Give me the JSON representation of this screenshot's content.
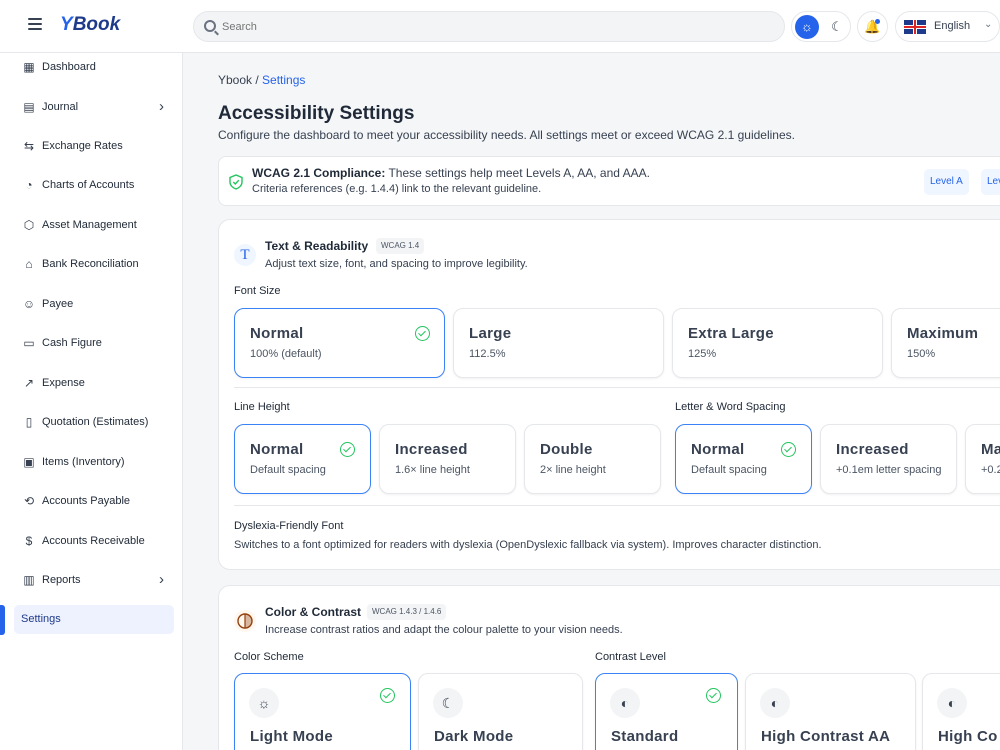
{
  "app": {
    "logo_y": "Y",
    "logo_rest": "Book"
  },
  "search": {
    "placeholder": "Search"
  },
  "language": {
    "label": "English"
  },
  "sidebar": {
    "items": [
      {
        "label": "Dashboard",
        "icon": "grid-icon"
      },
      {
        "label": "Journal",
        "icon": "book-icon"
      },
      {
        "label": "Exchange Rates",
        "icon": "swap-icon"
      },
      {
        "label": "Charts of Accounts",
        "icon": "pie-icon"
      },
      {
        "label": "Asset Management",
        "icon": "box-icon"
      },
      {
        "label": "Bank Reconciliation",
        "icon": "bank-icon"
      },
      {
        "label": "Payee",
        "icon": "users-icon"
      },
      {
        "label": "Cash Figure",
        "icon": "wallet-icon"
      },
      {
        "label": "Expense",
        "icon": "trend-icon"
      },
      {
        "label": "Quotation (Estimates)",
        "icon": "clipboard-icon"
      },
      {
        "label": "Items (Inventory)",
        "icon": "inventory-icon"
      },
      {
        "label": "Accounts Payable",
        "icon": "repeat-icon"
      },
      {
        "label": "Accounts Receivable",
        "icon": "dollar-icon"
      },
      {
        "label": "Reports",
        "icon": "bars-icon"
      },
      {
        "label": "Settings",
        "icon": ""
      }
    ]
  },
  "breadcrumb": {
    "root": "Ybook",
    "sep": " / ",
    "current": "Settings"
  },
  "page": {
    "title": "Accessibility Settings",
    "subtitle": "Configure the dashboard to meet your accessibility needs. All settings meet or exceed WCAG 2.1 guidelines."
  },
  "banner": {
    "bold": "WCAG 2.1 Compliance:",
    "text": " These settings help meet Levels A, AA, and AAA.",
    "line2": "Criteria references (e.g. 1.4.4) link to the relevant guideline.",
    "levels": [
      "Level A",
      "Level AA"
    ]
  },
  "text_section": {
    "icon_glyph": "T",
    "title": "Text & Readability",
    "wcag": "WCAG 1.4",
    "desc": "Adjust text size, font, and spacing to improve legibility.",
    "font_size_label": "Font Size",
    "font_sizes": [
      {
        "title": "Normal",
        "sub": "100% (default)",
        "selected": true
      },
      {
        "title": "Large",
        "sub": "112.5%"
      },
      {
        "title": "Extra Large",
        "sub": "125%"
      },
      {
        "title": "Maximum",
        "sub": "150%"
      }
    ],
    "line_height_label": "Line Height",
    "line_heights": [
      {
        "title": "Normal",
        "sub": "Default spacing",
        "selected": true
      },
      {
        "title": "Increased",
        "sub": "1.6× line height"
      },
      {
        "title": "Double",
        "sub": "2× line height"
      }
    ],
    "spacing_label": "Letter & Word Spacing",
    "spacings": [
      {
        "title": "Normal",
        "sub": "Default spacing",
        "selected": true
      },
      {
        "title": "Increased",
        "sub": "+0.1em letter spacing"
      },
      {
        "title": "Ma",
        "sub": "+0.2"
      }
    ],
    "dyslexia_title": "Dyslexia-Friendly Font",
    "dyslexia_desc": "Switches to a font optimized for readers with dyslexia (OpenDyslexic fallback via system). Improves character distinction."
  },
  "color_section": {
    "title": "Color & Contrast",
    "wcag": "WCAG 1.4.3 / 1.4.6",
    "desc": "Increase contrast ratios and adapt the colour palette to your vision needs.",
    "scheme_label": "Color Scheme",
    "schemes": [
      {
        "title": "Light Mode",
        "icon": "sun-icon",
        "glyph": "☼",
        "selected": true
      },
      {
        "title": "Dark Mode",
        "icon": "moon-icon",
        "glyph": "☾"
      }
    ],
    "contrast_label": "Contrast Level",
    "contrasts": [
      {
        "title": "Standard",
        "icon": "contrast-icon",
        "glyph": "◐",
        "selected": true
      },
      {
        "title": "High Contrast AA",
        "icon": "contrast-icon",
        "glyph": "◐"
      },
      {
        "title": "High Co",
        "icon": "contrast-icon",
        "glyph": "◐"
      }
    ]
  },
  "colors": {
    "accent": "#2563eb",
    "selected_border": "#3b82f6",
    "check": "#22c55e"
  }
}
